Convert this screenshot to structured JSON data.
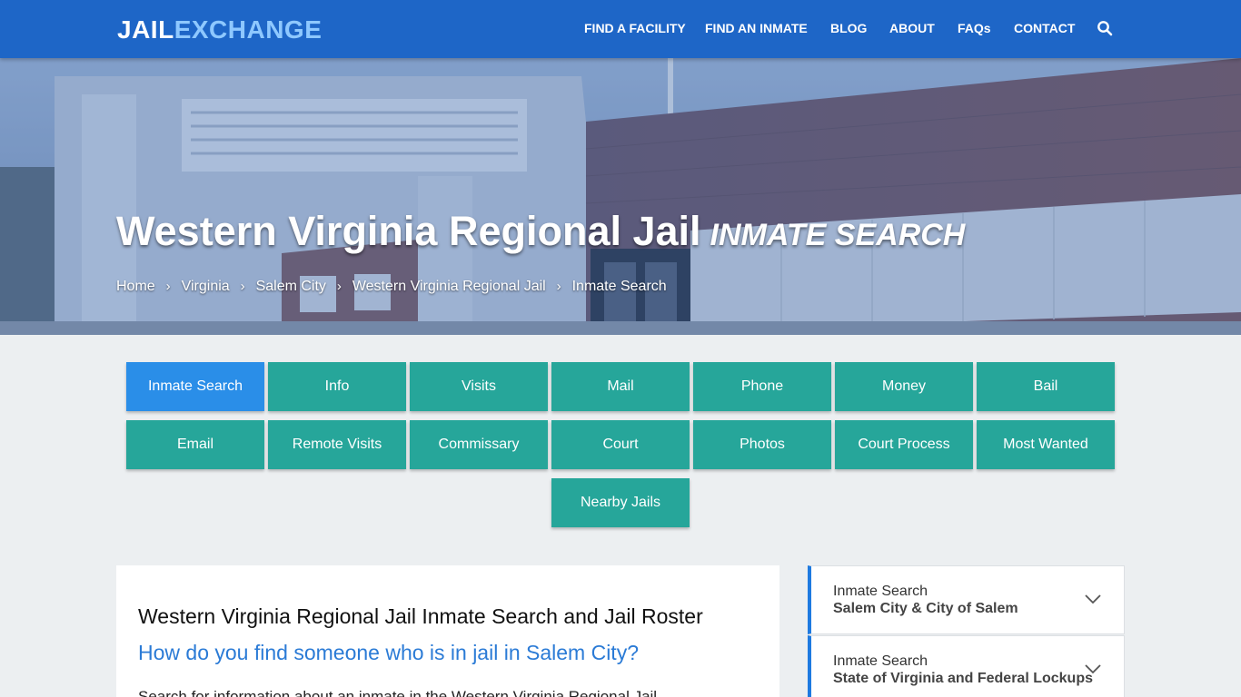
{
  "brand": {
    "part1": "JAIL",
    "part2": "EXCHANGE"
  },
  "nav": {
    "items": [
      "FIND A FACILITY",
      "FIND AN INMATE",
      "BLOG",
      "ABOUT",
      "FAQs",
      "CONTACT"
    ],
    "search_icon": "search-icon"
  },
  "hero": {
    "title": "Western Virginia Regional Jail",
    "subtitle": "INMATE SEARCH",
    "breadcrumb": [
      "Home",
      "Virginia",
      "Salem City",
      "Western Virginia Regional Jail",
      "Inmate Search"
    ]
  },
  "tabs": {
    "row1": [
      "Inmate Search",
      "Info",
      "Visits",
      "Mail",
      "Phone",
      "Money",
      "Bail"
    ],
    "row2": [
      "Email",
      "Remote Visits",
      "Commissary",
      "Court",
      "Photos",
      "Court Process",
      "Most Wanted"
    ],
    "row3": [
      "Nearby Jails"
    ],
    "active": "Inmate Search"
  },
  "main": {
    "title": "Western Virginia Regional Jail Inmate Search and Jail Roster",
    "question": "How do you find someone who is in jail in Salem City?",
    "intro": "Search for information about an inmate in the Western Virginia Regional Jail"
  },
  "sidebar": {
    "items": [
      {
        "line1": "Inmate Search",
        "line2": "Salem City & City of Salem"
      },
      {
        "line1": "Inmate Search",
        "line2": "State of Virginia and Federal Lockups"
      }
    ]
  },
  "colors": {
    "nav_bg": "#1e66c7",
    "tab_bg": "#26a69a",
    "tab_active": "#2a8ee8",
    "link_blue": "#2b7bd6",
    "sidebar_accent": "#1e7ae0",
    "page_bg": "#eceff1"
  }
}
